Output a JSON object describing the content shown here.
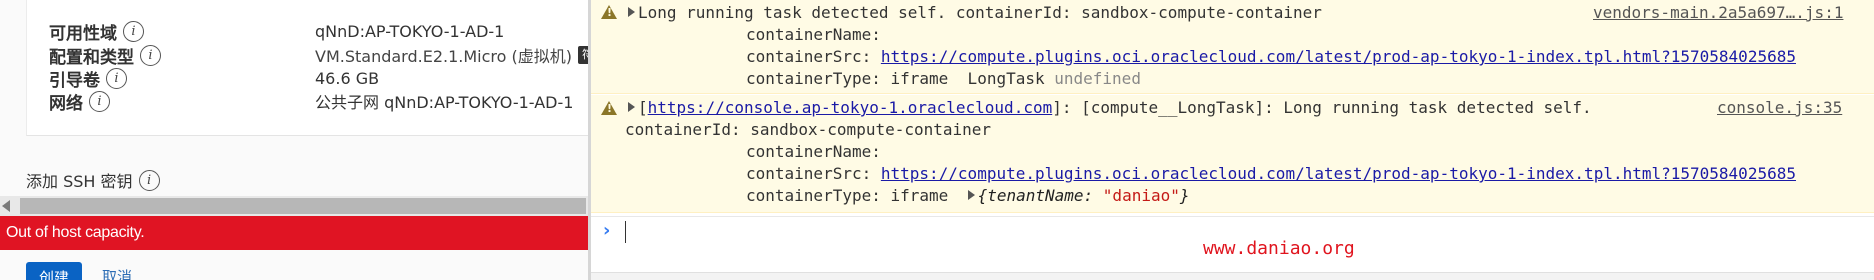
{
  "instance_details": {
    "rows": [
      {
        "label": "可用性域",
        "value": "qNnD:AP-TOKYO-1-AD-1"
      },
      {
        "label": "配置和类型",
        "value": "VM.Standard.E2.1.Micro (虚拟机)",
        "badge": "符合"
      },
      {
        "label": "引导卷",
        "value": "46.6 GB"
      },
      {
        "label": "网络",
        "value": "公共子网 qNnD:AP-TOKYO-1-AD-1"
      }
    ],
    "info_glyph": "i"
  },
  "ssh": {
    "label": "添加 SSH 密钥"
  },
  "error": {
    "message": "Out of host capacity."
  },
  "actions": {
    "create": "创建",
    "cancel": "取消"
  },
  "console": {
    "warning1": {
      "line1": "Long running task detected self. containerId: sandbox-compute-container",
      "source": "vendors-main.2a5a697….js:1",
      "line2": "containerName:",
      "line3_label": "containerSrc: ",
      "line3_link": "https://compute.plugins.oci.oraclecloud.com/latest/prod-ap-tokyo-1-index.tpl.html?1570584025685",
      "line4_label": "containerType: iframe  LongTask ",
      "line4_gray": "undefined"
    },
    "warning2": {
      "prefix": "[",
      "link": "https://console.ap-tokyo-1.oraclecloud.com",
      "rest": "]: [compute__LongTask]: Long running task detected self.",
      "source": "console.js:35",
      "line2": "containerId: sandbox-compute-container",
      "line3": "containerName:",
      "line4_label": "containerSrc: ",
      "line4_link": "https://compute.plugins.oci.oraclecloud.com/latest/prod-ap-tokyo-1-index.tpl.html?1570584025685",
      "line5_label": "containerType: iframe  ",
      "obj_open": "{tenantName: ",
      "obj_value": "\"daniao\"",
      "obj_close": "}"
    },
    "prompt_symbol": "›",
    "watermark": "www.daniao.org"
  },
  "colors": {
    "error_bar": "#e01423",
    "warning_bg": "#fffbe5",
    "primary_button": "#0a63c4",
    "watermark": "#e0141e"
  }
}
